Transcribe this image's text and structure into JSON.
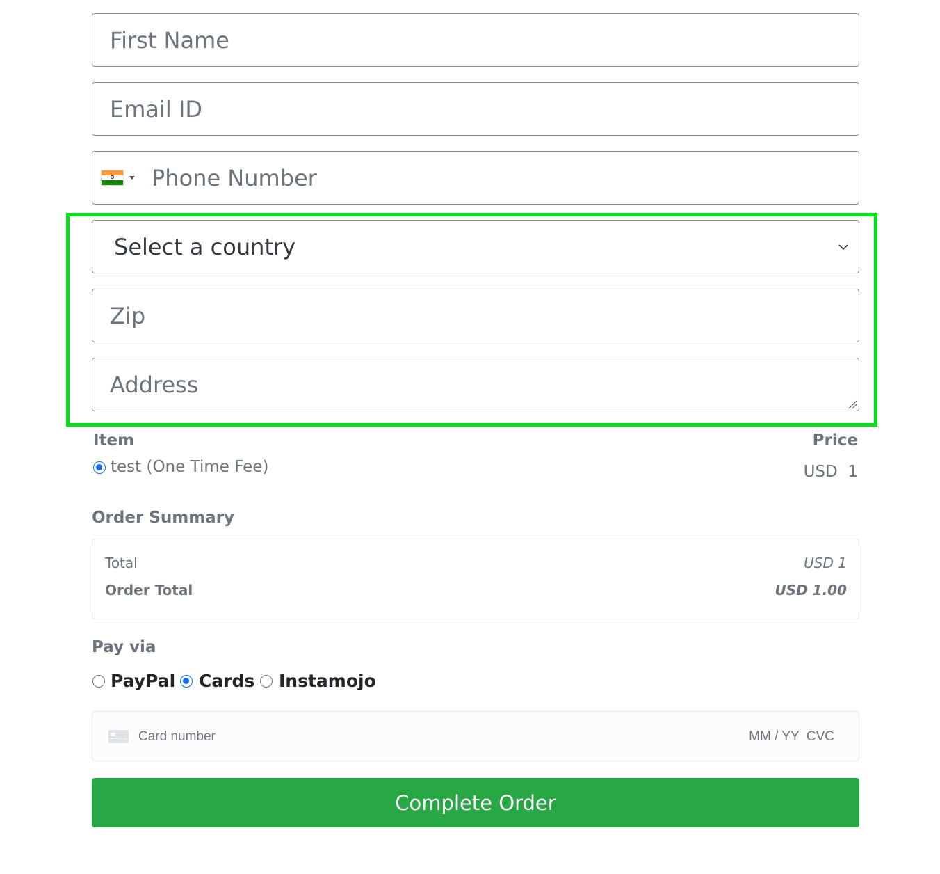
{
  "form": {
    "first_name_placeholder": "First Name",
    "email_placeholder": "Email ID",
    "phone_placeholder": "Phone Number",
    "country_select_value": "Select a country",
    "zip_placeholder": "Zip",
    "address_placeholder": "Address"
  },
  "items": {
    "header_item": "Item",
    "header_price": "Price",
    "rows": [
      {
        "label": "test (One Time Fee)",
        "price": "USD  1",
        "selected": true
      }
    ]
  },
  "summary": {
    "title": "Order Summary",
    "total_label": "Total",
    "total_value": "USD 1",
    "order_total_label": "Order Total",
    "order_total_value": "USD 1.00"
  },
  "payment": {
    "title": "Pay via",
    "options": [
      {
        "label": "PayPal",
        "selected": false
      },
      {
        "label": "Cards",
        "selected": true
      },
      {
        "label": "Instamojo",
        "selected": false
      }
    ],
    "card_number_placeholder": "Card number",
    "expiry_cvc_placeholder": "MM / YY  CVC"
  },
  "actions": {
    "complete_order_label": "Complete Order"
  },
  "colors": {
    "highlight": "#00e31a",
    "button": "#28a745",
    "radio_selected": "#0d6efd"
  },
  "icons": {
    "phone_flag": "india-flag-icon",
    "select_chevron": "chevron-down-icon",
    "card": "credit-card-icon"
  }
}
